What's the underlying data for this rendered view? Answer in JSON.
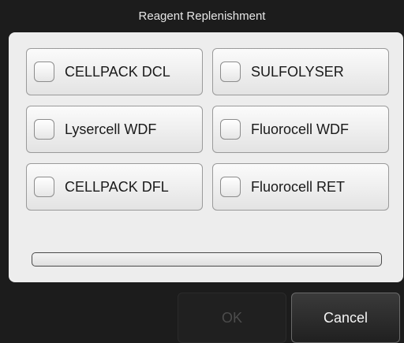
{
  "dialog": {
    "title": "Reagent Replenishment"
  },
  "reagents": [
    {
      "label": "CELLPACK DCL",
      "checked": false
    },
    {
      "label": "SULFOLYSER",
      "checked": false
    },
    {
      "label": "Lysercell WDF",
      "checked": false
    },
    {
      "label": "Fluorocell WDF",
      "checked": false
    },
    {
      "label": "CELLPACK DFL",
      "checked": false
    },
    {
      "label": "Fluorocell RET",
      "checked": false
    }
  ],
  "progress": {
    "value": 0
  },
  "footer": {
    "ok_label": "OK",
    "ok_enabled": false,
    "cancel_label": "Cancel"
  },
  "colors": {
    "title_bar_bg": "#1c1c1c",
    "panel_bg": "#ededed",
    "button_text": "#1a1a1a"
  }
}
